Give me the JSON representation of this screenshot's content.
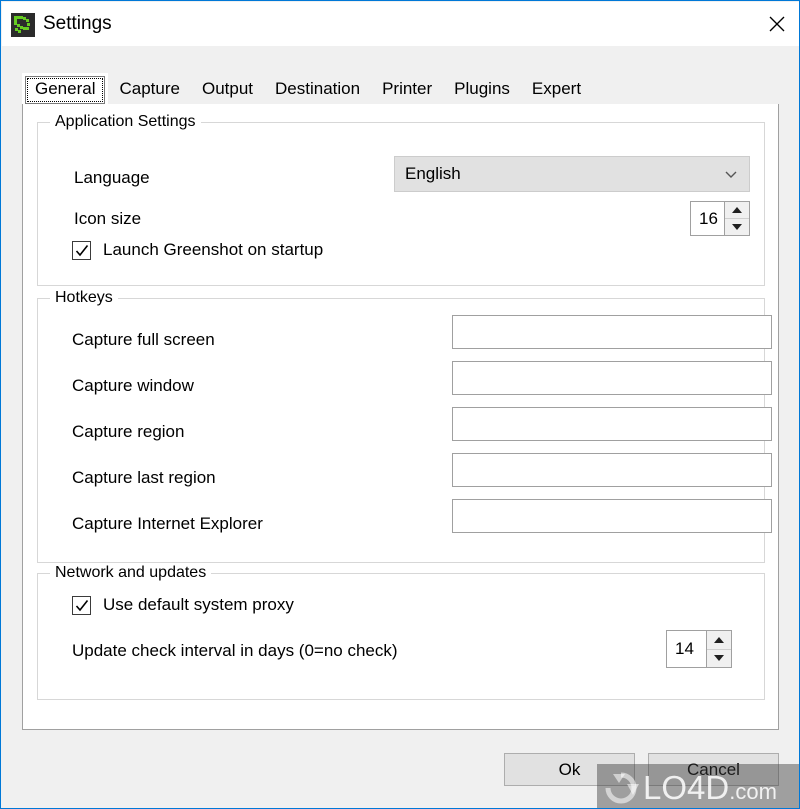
{
  "window": {
    "title": "Settings",
    "icon": "greenshot-icon",
    "close_label": "✕",
    "border_color": "#0078d7",
    "titlebar_bg": "#ffffff",
    "body_bg": "#f0f0f0"
  },
  "tabs": [
    {
      "label": "General",
      "active": true
    },
    {
      "label": "Capture",
      "active": false
    },
    {
      "label": "Output",
      "active": false
    },
    {
      "label": "Destination",
      "active": false
    },
    {
      "label": "Printer",
      "active": false
    },
    {
      "label": "Plugins",
      "active": false
    },
    {
      "label": "Expert",
      "active": false
    }
  ],
  "application_settings": {
    "title": "Application Settings",
    "language": {
      "label": "Language",
      "value": "English",
      "arrow": "chevron-down-icon"
    },
    "icon_size": {
      "label": "Icon size",
      "value": "16"
    },
    "launch_on_startup": {
      "label": "Launch Greenshot on startup",
      "checked": true
    }
  },
  "hotkeys": {
    "title": "Hotkeys",
    "rows": [
      {
        "label": "Capture full screen",
        "value": ""
      },
      {
        "label": "Capture window",
        "value": ""
      },
      {
        "label": "Capture region",
        "value": ""
      },
      {
        "label": "Capture last region",
        "value": ""
      },
      {
        "label": "Capture Internet Explorer",
        "value": ""
      }
    ]
  },
  "network": {
    "title": "Network and updates",
    "use_proxy": {
      "label": "Use default system proxy",
      "checked": true
    },
    "update_interval": {
      "label": "Update check interval in days (0=no check)",
      "value": "14"
    }
  },
  "footer": {
    "ok_label": "Ok",
    "cancel_label": "Cancel"
  },
  "watermark": {
    "text": "LO4D",
    "tld": ".com",
    "logo": "refresh-circle-icon"
  }
}
